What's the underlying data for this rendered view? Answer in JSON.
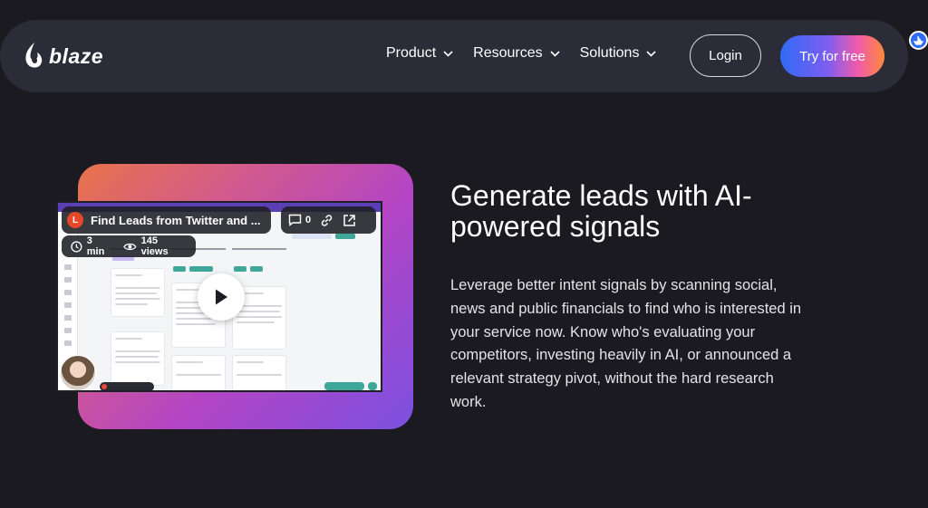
{
  "brand": {
    "name": "blaze"
  },
  "nav": {
    "items": [
      {
        "label": "Product"
      },
      {
        "label": "Resources"
      },
      {
        "label": "Solutions"
      }
    ],
    "login_label": "Login",
    "cta_label": "Try for free"
  },
  "video": {
    "avatar_initial": "L",
    "title": "Find Leads from Twitter and ...",
    "comment_count": "0",
    "duration": "3 min",
    "views": "145 views"
  },
  "hero": {
    "headline": "Generate leads with AI-powered signals",
    "body": "Leverage better intent signals by scanning social, news and public financials to find who is interested in your service now. Know who's evaluating your competitors, investing heavily in AI, or announced a relevant strategy pivot, without the hard research work."
  },
  "colors": {
    "background": "#1a1a20",
    "navbar": "#2c2c38",
    "cta_gradient_start": "#2f6bf5",
    "cta_gradient_end": "#ff8a3c",
    "accent_teal": "#3fa79a"
  }
}
